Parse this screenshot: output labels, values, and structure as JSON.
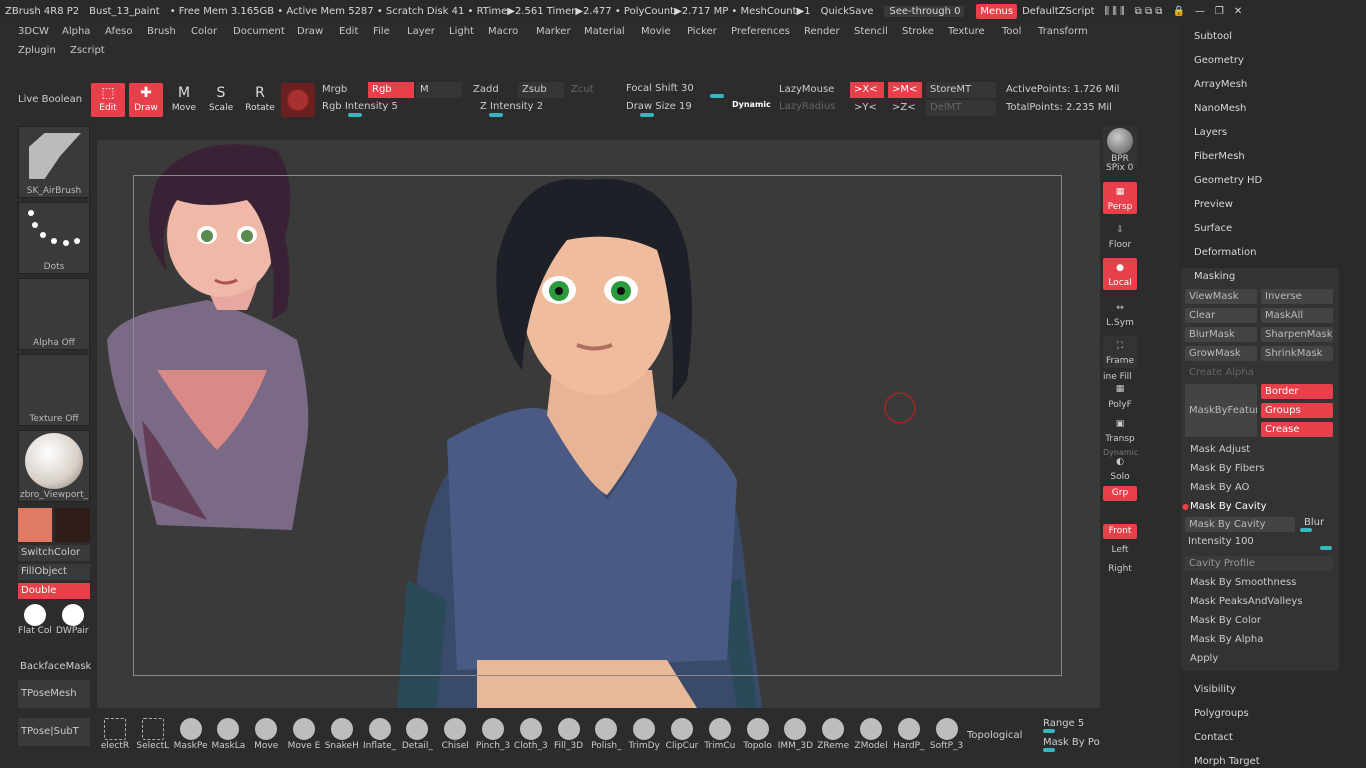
{
  "title": {
    "app": "ZBrush 4R8 P2",
    "doc": "Bust_13_paint",
    "stats": "• Free Mem 3.165GB • Active Mem 5287 • Scratch Disk 41 • RTime▶2.561 Timer▶2.477 • PolyCount▶2.717 MP • MeshCount▶1",
    "quicksave": "QuickSave",
    "seethrough": "See-through  0",
    "menus": "Menus",
    "script": "DefaultZScript"
  },
  "menu": [
    "3DCW",
    "Alpha",
    "Afeso",
    "Brush",
    "Color",
    "Document",
    "Draw",
    "Edit",
    "File",
    "Layer",
    "Light",
    "Macro",
    "Marker",
    "Material",
    "Movie",
    "Picker",
    "Preferences",
    "Render",
    "Stencil",
    "Stroke",
    "Texture",
    "Tool",
    "Transform",
    "Zplugin",
    "Zscript"
  ],
  "shelf": {
    "live_boolean": "Live Boolean",
    "edit": "Edit",
    "draw": "Draw",
    "move": "Move",
    "scale": "Scale",
    "rotate": "Rotate",
    "mrgb": "Mrgb",
    "rgb": "Rgb",
    "m": "M",
    "rgb_intensity": "Rgb Intensity 5",
    "zadd": "Zadd",
    "zsub": "Zsub",
    "zcut": "Zcut",
    "z_intensity": "Z Intensity 2",
    "focal_shift": "Focal Shift 30",
    "draw_size": "Draw Size 19",
    "dynamic": "Dynamic",
    "lazymouse": "LazyMouse",
    "lazyradius": "LazyRadius",
    "x": ">X<",
    "m2": ">M<",
    "y": ">Y<",
    "z": ">Z<",
    "storemt": "StoreMT",
    "delmt": "DelMT",
    "active_points": "ActivePoints: 1.726 Mil",
    "total_points": "TotalPoints: 2.235 Mil"
  },
  "left": {
    "brush": "SK_AirBrush",
    "stroke": "Dots",
    "alpha": "Alpha Off",
    "texture": "Texture Off",
    "material": "zbro_Viewport_",
    "switchcolor": "SwitchColor",
    "fillobject": "FillObject",
    "double": "Double",
    "flatcol": "Flat Col",
    "dwpair": "DWPair",
    "backfacemask": "BackfaceMask",
    "tposemesh": "TPoseMesh",
    "tposesubt": "TPose|SubT",
    "main_color": "#e07a62",
    "secondary_color": "#2e1c18"
  },
  "right_shelf": {
    "bpr": "BPR",
    "spix": "SPix 0",
    "persp": "Persp",
    "floor": "Floor",
    "local": "Local",
    "lsym": "L.Sym",
    "frame": "Frame",
    "polyf": "PolyF",
    "linefill": "ine Fill",
    "transp": "Transp",
    "dynamic": "Dynamic",
    "solo": "Solo",
    "grp": "Grp",
    "front": "Front",
    "left": "Left",
    "right": "Right"
  },
  "palette": {
    "items_top": [
      "Subtool",
      "Geometry",
      "ArrayMesh",
      "NanoMesh",
      "Layers",
      "FiberMesh",
      "Geometry HD",
      "Preview",
      "Surface",
      "Deformation"
    ],
    "masking": "Masking",
    "viewmask": "ViewMask",
    "inverse": "Inverse",
    "clear": "Clear",
    "maskall": "MaskAll",
    "blurmask": "BlurMask",
    "sharpenmask": "SharpenMask",
    "growmask": "GrowMask",
    "shrinkmask": "ShrinkMask",
    "createalpha": "Create Alpha",
    "maskbyfeature": "MaskByFeatur",
    "border": "Border",
    "groups": "Groups",
    "crease": "Crease",
    "mask_adjust": "Mask Adjust",
    "mask_fibers": "Mask By Fibers",
    "mask_ao": "Mask By AO",
    "mask_cavity": "Mask By Cavity",
    "mask_cavity_btn": "Mask By Cavity",
    "blur": "Blur",
    "intensity": "Intensity 100",
    "cavity_profile": "Cavity Profile",
    "mask_smooth": "Mask By Smoothness",
    "mask_peaks": "Mask PeaksAndValleys",
    "mask_color": "Mask By Color",
    "mask_alpha": "Mask By Alpha",
    "apply": "Apply",
    "items_bottom": [
      "Visibility",
      "Polygroups",
      "Contact",
      "Morph Target"
    ]
  },
  "bottom": {
    "brushes": [
      "electR",
      "SelectL",
      "MaskPe",
      "MaskLa",
      "Move",
      "Move E",
      "SnakeH",
      "Inflate_",
      "Detail_",
      "Chisel",
      "Pinch_3",
      "Cloth_3",
      "Fill_3D",
      "Polish_",
      "TrimDy",
      "ClipCur",
      "TrimCu",
      "Topolo",
      "IMM_3D",
      "ZReme",
      "ZModel",
      "HardP_",
      "SoftP_3"
    ],
    "topological": "Topological",
    "range": "Range 5",
    "maskbypo": "Mask By Po"
  }
}
